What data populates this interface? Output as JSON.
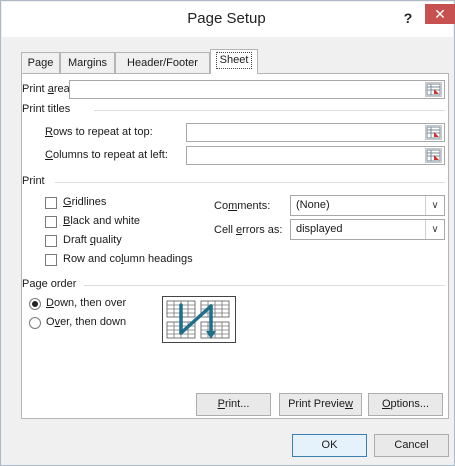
{
  "window": {
    "title": "Page Setup",
    "help_label": "?",
    "close_label": "✕"
  },
  "tabs": [
    {
      "label": "Page"
    },
    {
      "label": "Margins"
    },
    {
      "label": "Header/Footer"
    },
    {
      "label": "Sheet"
    }
  ],
  "print_area": {
    "label_pre": "Print ",
    "label_u": "a",
    "label_post": "rea:",
    "value": ""
  },
  "print_titles": {
    "heading": "Print titles",
    "rows_pre": "",
    "rows_u": "R",
    "rows_post": "ows to repeat at top:",
    "rows_value": "",
    "cols_pre": "",
    "cols_u": "C",
    "cols_post": "olumns to repeat at left:",
    "cols_value": ""
  },
  "print": {
    "heading": "Print",
    "gridlines_u": "G",
    "gridlines_post": "ridlines",
    "gridlines_checked": false,
    "bw_u": "B",
    "bw_post": "lack and white",
    "bw_checked": false,
    "draft_pre": "Draft ",
    "draft_u": "q",
    "draft_post": "uality",
    "draft_checked": false,
    "rc_pre": "Row and co",
    "rc_u": "l",
    "rc_post": "umn headings",
    "rc_checked": false,
    "comments_pre": "Co",
    "comments_u": "m",
    "comments_post": "ments:",
    "comments_value": "(None)",
    "errors_pre": "Cell ",
    "errors_u": "e",
    "errors_post": "rrors as:",
    "errors_value": "displayed"
  },
  "page_order": {
    "heading": "Page order",
    "down_u": "D",
    "down_post": "own, then over",
    "down_selected": true,
    "over_pre": "O",
    "over_u": "v",
    "over_post": "er, then down",
    "over_selected": false
  },
  "buttons": {
    "print_u": "P",
    "print_post": "rint...",
    "preview_pre": "Print Previe",
    "preview_u": "w",
    "preview_post": "",
    "options_u": "O",
    "options_post": "ptions...",
    "ok": "OK",
    "cancel": "Cancel"
  }
}
